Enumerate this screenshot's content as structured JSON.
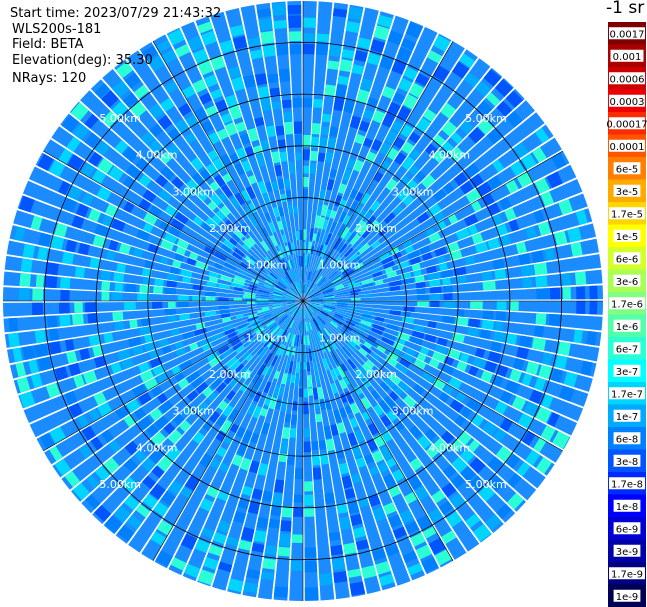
{
  "info": {
    "start_time": "Start time: 2023/07/29 21:43:32",
    "instrument": "WLS200s-181",
    "field": "Field: BETA",
    "elevation": "Elevation(deg): 35.30",
    "nrays": "NRays: 120"
  },
  "colorbar": {
    "title": "-1 sr",
    "entries": [
      {
        "label": "0.0017",
        "color": "#800000"
      },
      {
        "label": "0.001",
        "color": "#aa0000"
      },
      {
        "label": "0.0006",
        "color": "#cc0000"
      },
      {
        "label": "0.0003",
        "color": "#ee0000"
      },
      {
        "label": "0.00017",
        "color": "#ff2a00"
      },
      {
        "label": "0.0001",
        "color": "#ff5500"
      },
      {
        "label": "6e-5",
        "color": "#ff8000"
      },
      {
        "label": "3e-5",
        "color": "#ffaa00"
      },
      {
        "label": "1.7e-5",
        "color": "#ffd500"
      },
      {
        "label": "1e-5",
        "color": "#ffff00"
      },
      {
        "label": "6e-6",
        "color": "#d5ff2a"
      },
      {
        "label": "3e-6",
        "color": "#aaff55"
      },
      {
        "label": "1.7e-6",
        "color": "#80ff80"
      },
      {
        "label": "1e-6",
        "color": "#55ffaa"
      },
      {
        "label": "6e-7",
        "color": "#2affd5"
      },
      {
        "label": "3e-7",
        "color": "#00ffff"
      },
      {
        "label": "1.7e-7",
        "color": "#00d5ff"
      },
      {
        "label": "1e-7",
        "color": "#00aaff"
      },
      {
        "label": "6e-8",
        "color": "#0080ff"
      },
      {
        "label": "3e-8",
        "color": "#0055ff"
      },
      {
        "label": "1.7e-8",
        "color": "#002aff"
      },
      {
        "label": "1e-8",
        "color": "#0000ff"
      },
      {
        "label": "6e-9",
        "color": "#0000d5"
      },
      {
        "label": "3e-9",
        "color": "#0000aa"
      },
      {
        "label": "1.7e-9",
        "color": "#000080"
      },
      {
        "label": "1e-9",
        "color": "#000055"
      }
    ]
  },
  "chart_data": {
    "type": "heatmap",
    "projection": "polar-ppi",
    "nrays": 120,
    "max_range_km": 5.8,
    "range_rings_km": [
      1.0,
      2.0,
      3.0,
      4.0,
      5.0
    ],
    "ring_labels": [
      "1.00km",
      "2.00km",
      "3.00km",
      "4.00km",
      "5.00km"
    ],
    "spoke_angles_deg": [
      0,
      30,
      60,
      90,
      120,
      150,
      180,
      210,
      240,
      270,
      300,
      330
    ],
    "value_range": "mostly 1e-8 to 3e-7 sr^-1",
    "dominant_colors": [
      "#0080ff",
      "#00aaff",
      "#00d5ff",
      "#0055ff",
      "#2affd5"
    ]
  }
}
